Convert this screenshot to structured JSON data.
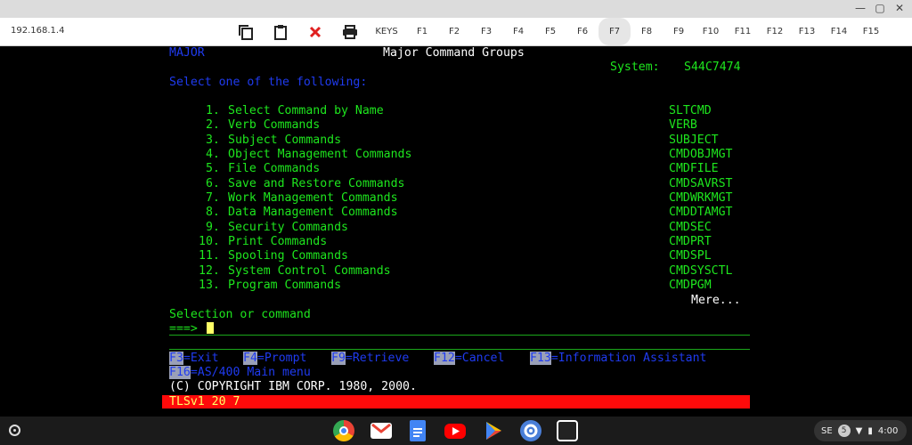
{
  "browser": {
    "address": "192.168.1.4",
    "keys_label": "KEYS",
    "fkeys": [
      "F1",
      "F2",
      "F3",
      "F4",
      "F5",
      "F6",
      "F7",
      "F8",
      "F9",
      "F10",
      "F11",
      "F12",
      "F13",
      "F14",
      "F15"
    ],
    "active_fkey": "F7"
  },
  "screen": {
    "menu_id": "MAJOR",
    "title": "Major Command Groups",
    "system_label": "System:",
    "system_name": "S44C7474",
    "prompt": "Select one of the following:",
    "options": [
      {
        "num": " 1.",
        "label": "Select Command by Name",
        "cmd": "SLTCMD"
      },
      {
        "num": " 2.",
        "label": "Verb Commands",
        "cmd": "VERB"
      },
      {
        "num": " 3.",
        "label": "Subject Commands",
        "cmd": "SUBJECT"
      },
      {
        "num": " 4.",
        "label": "Object Management Commands",
        "cmd": "CMDOBJMGT"
      },
      {
        "num": " 5.",
        "label": "File Commands",
        "cmd": "CMDFILE"
      },
      {
        "num": " 6.",
        "label": "Save and Restore Commands",
        "cmd": "CMDSAVRST"
      },
      {
        "num": " 7.",
        "label": "Work Management Commands",
        "cmd": "CMDWRKMGT"
      },
      {
        "num": " 8.",
        "label": "Data Management Commands",
        "cmd": "CMDDTAMGT"
      },
      {
        "num": " 9.",
        "label": "Security Commands",
        "cmd": "CMDSEC"
      },
      {
        "num": "10.",
        "label": "Print Commands",
        "cmd": "CMDPRT"
      },
      {
        "num": "11.",
        "label": "Spooling Commands",
        "cmd": "CMDSPL"
      },
      {
        "num": "12.",
        "label": "System Control Commands",
        "cmd": "CMDSYSCTL"
      },
      {
        "num": "13.",
        "label": "Program Commands",
        "cmd": "CMDPGM"
      }
    ],
    "more": "Mere...",
    "selection_label": "Selection or command",
    "input_prompt": "===>",
    "function_keys": [
      {
        "key": "F3",
        "label": "=Exit"
      },
      {
        "key": "F4",
        "label": "=Prompt"
      },
      {
        "key": "F9",
        "label": "=Retrieve"
      },
      {
        "key": "F12",
        "label": "=Cancel"
      },
      {
        "key": "F13",
        "label": "=Information Assistant"
      },
      {
        "key": "F16",
        "label": "=AS/400 Main menu"
      }
    ],
    "copyright": "(C) COPYRIGHT IBM CORP. 1980, 2000.",
    "status": "TLSv1 20 7"
  },
  "shelf": {
    "apps": [
      "chrome-icon",
      "gmail-icon",
      "docs-icon",
      "youtube-icon",
      "play-store-icon",
      "settings-icon",
      "terminal-app-icon"
    ],
    "locale": "SE",
    "notification_count": "5",
    "time": "4:00"
  }
}
